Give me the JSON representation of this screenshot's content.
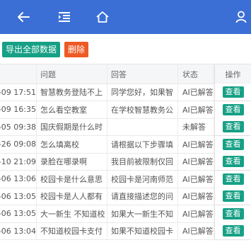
{
  "header": {
    "back_icon": "arrow-left-icon",
    "menu_icon": "outdent-menu-icon",
    "home_icon": "home-icon",
    "user_icon": "user-icon",
    "color": "#3b6fd6"
  },
  "toolbar": {
    "export_label": "导出全部数据",
    "delete_label": "删除",
    "export_color": "#16a085",
    "delete_color": "#ee5a24"
  },
  "table": {
    "columns": {
      "time": "",
      "question": "问题",
      "answer": "回答",
      "status": "状态",
      "operation": "操作"
    },
    "view_label": "查看",
    "rows": [
      {
        "time": "-09 17:51",
        "question": "智慧教务登陆不上",
        "answer": "同学您好，如果智",
        "status": "AI已解答"
      },
      {
        "time": "-09 16:35",
        "question": "怎么看空教室",
        "answer": "在学校智慧教务公",
        "status": "AI已解答"
      },
      {
        "time": "-05 09:38",
        "question": "国庆假期是什么时",
        "answer": "",
        "status": "未解答"
      },
      {
        "time": "-26 09:08",
        "question": "怎么填离校",
        "answer": "请根据以下步骤填",
        "status": "AI已解答"
      },
      {
        "time": "-10 21:09",
        "question": "录脸在哪录啊",
        "answer": "我目前被限制仅回",
        "status": "AI已解答"
      },
      {
        "time": "-06 13:06",
        "question": "校园卡是什么意思",
        "answer": "校园卡是河南师范",
        "status": "AI已解答"
      },
      {
        "time": "-06 13:05",
        "question": "校园卡是人人都有",
        "answer": "请直接描述您的问",
        "status": "AI已解答"
      },
      {
        "time": "-06 13:05",
        "question": "大一新生 不知道校",
        "answer": "如果大一新生不知",
        "status": "AI已解答"
      },
      {
        "time": "-06 13:04",
        "question": "不知道校园卡支付",
        "answer": "如果不知道校园卡",
        "status": "AI已解答"
      }
    ]
  }
}
